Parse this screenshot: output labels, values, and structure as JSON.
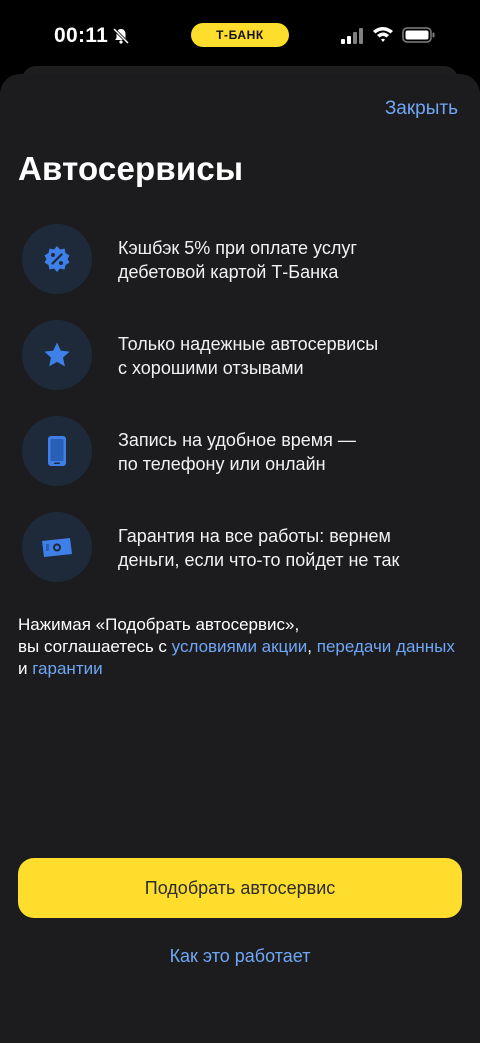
{
  "status_bar": {
    "time": "00:11",
    "brand": "Т-БАНК",
    "icons": [
      "bell-slash-icon",
      "cellular-signal-icon",
      "wifi-icon",
      "battery-icon"
    ]
  },
  "sheet": {
    "close_label": "Закрыть",
    "title": "Автосервисы",
    "features": [
      {
        "icon": "cashback-percent-badge-icon",
        "line1": "Кэшбэк 5% при оплате услуг",
        "line2": "дебетовой картой Т-Банка"
      },
      {
        "icon": "star-icon",
        "line1": "Только надежные автосервисы",
        "line2": "с хорошими отзывами"
      },
      {
        "icon": "phone-icon",
        "line1": "Запись на удобное время —",
        "line2": "по телефону или онлайн"
      },
      {
        "icon": "banknote-icon",
        "line1": "Гарантия на все работы: вернем",
        "line2": "деньги, если что-то пойдет не так"
      }
    ],
    "terms": {
      "prefix": "Нажимая «Подобрать автосервис»,",
      "line2_start": "вы соглашаетесь с ",
      "link_promo": "условиями акции",
      "comma": ", ",
      "link_data": "передачи данных",
      "and": " и ",
      "link_warranty": "гарантии"
    },
    "primary_button": "Подобрать автосервис",
    "secondary_link": "Как это работает"
  },
  "colors": {
    "accent_yellow": "#ffdd2d",
    "link_blue": "#6fa6f5",
    "sheet_bg": "#1c1c1e",
    "icon_circle_bg": "#1e2a3a",
    "icon_blue": "#3f7fe8"
  }
}
